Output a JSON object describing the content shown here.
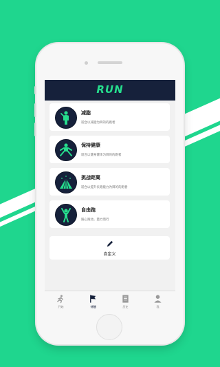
{
  "app": {
    "title": "RUN"
  },
  "plans": [
    {
      "title": "减脂",
      "subtitle": "适合以减脂为目的的跑者",
      "icon": "figure-icon"
    },
    {
      "title": "保持健康",
      "subtitle": "适合以健身健体为目的的跑者",
      "icon": "stretching-figure-icon"
    },
    {
      "title": "挑战距离",
      "subtitle": "适合以提升长跑能力为目的的跑者",
      "icon": "running-track-icon"
    },
    {
      "title": "自由跑",
      "subtitle": "随心跑动，量力而行",
      "icon": "arms-raised-figure-icon"
    }
  ],
  "custom": {
    "label": "自定义",
    "icon": "pencil-icon"
  },
  "tabs": [
    {
      "label": "开始",
      "icon": "runner-icon",
      "active": false
    },
    {
      "label": "计划",
      "icon": "flag-icon",
      "active": true
    },
    {
      "label": "历史",
      "icon": "notebook-icon",
      "active": false
    },
    {
      "label": "我",
      "icon": "person-icon",
      "active": false
    }
  ],
  "colors": {
    "background": "#1fd68e",
    "header": "#16213b",
    "accent": "#26dd8d"
  }
}
